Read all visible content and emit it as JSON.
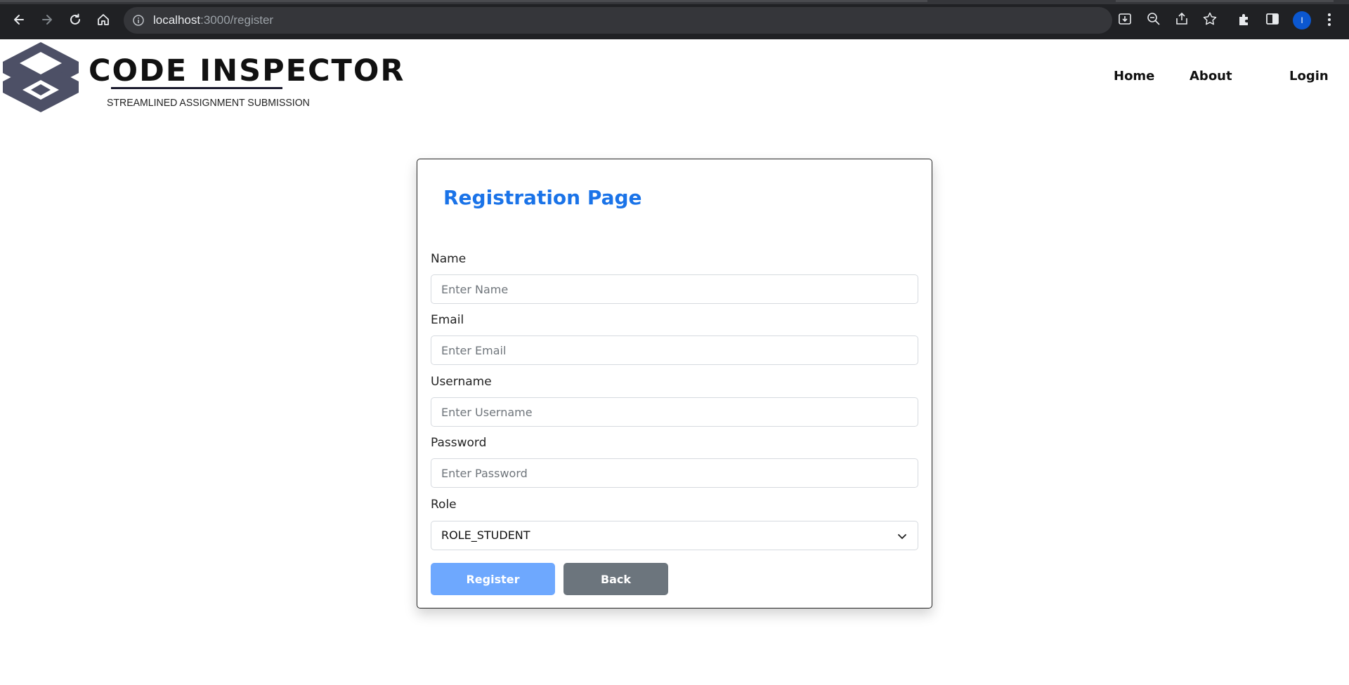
{
  "browser": {
    "url_host": "localhost",
    "url_path": ":3000/register",
    "profile_initial": "I",
    "icons": [
      "back-icon",
      "forward-icon",
      "reload-icon",
      "home-icon",
      "info-icon",
      "install-icon",
      "zoom-icon",
      "share-icon",
      "star-icon",
      "extensions-icon",
      "side-panel-icon",
      "menu-icon"
    ]
  },
  "header": {
    "brand_title": "CODE INSPECTOR",
    "brand_tagline": "STREAMLINED ASSIGNMENT SUBMISSION",
    "nav": {
      "home": "Home",
      "about": "About",
      "login": "Login"
    }
  },
  "form": {
    "title": "Registration Page",
    "name_label": "Name",
    "name_placeholder": "Enter Name",
    "email_label": "Email",
    "email_placeholder": "Enter Email",
    "username_label": "Username",
    "username_placeholder": "Enter Username",
    "password_label": "Password",
    "password_placeholder": "Enter Password",
    "role_label": "Role",
    "role_value": "ROLE_STUDENT",
    "register_label": "Register",
    "back_label": "Back"
  },
  "colors": {
    "title_blue": "#1a73e8",
    "register_btn": "#6ea8fe",
    "back_btn": "#6c757d",
    "logo_gray": "#4d5066"
  }
}
